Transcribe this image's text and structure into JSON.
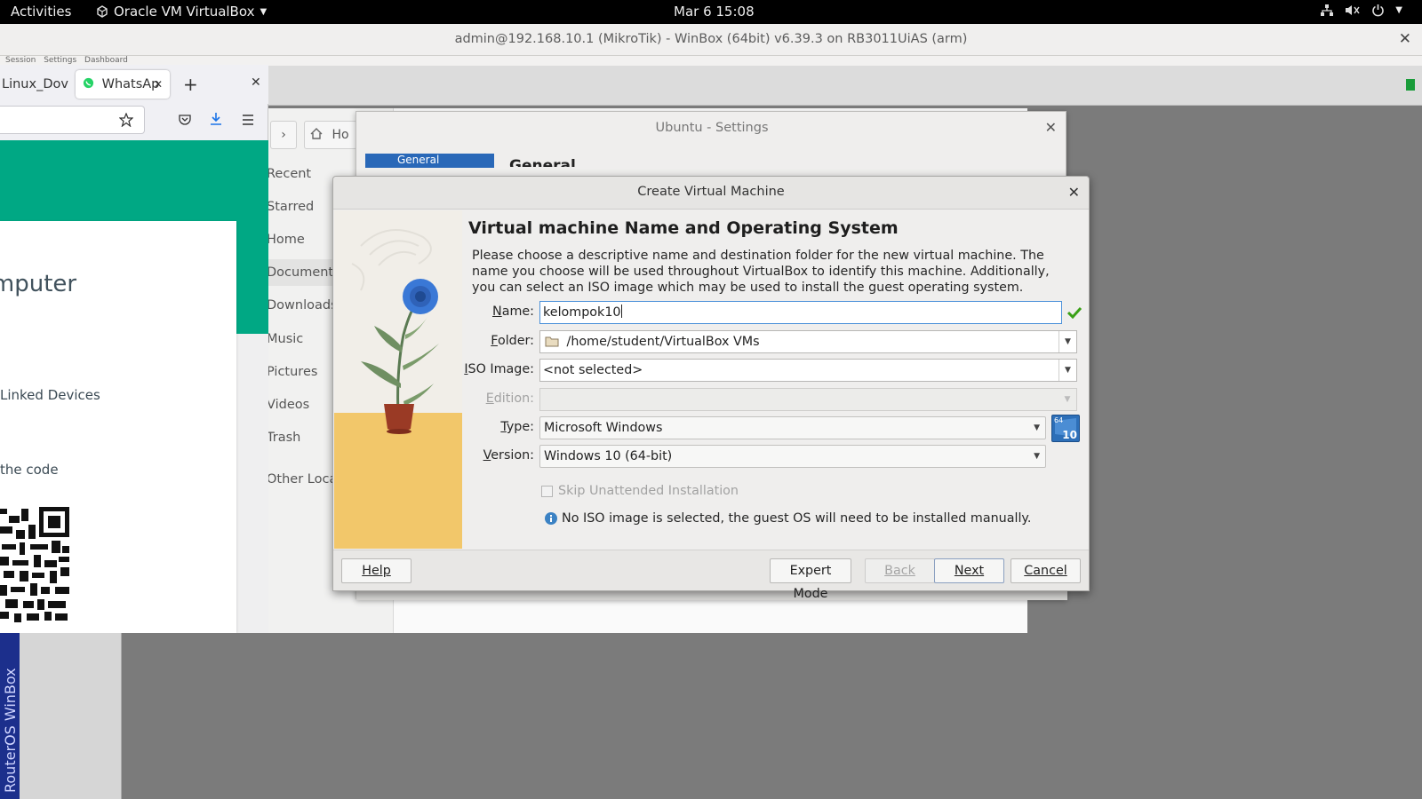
{
  "topbar": {
    "activities": "Activities",
    "app_name": "Oracle VM VirtualBox",
    "clock": "Mar 6  15:08"
  },
  "winbox": {
    "title": "admin@192.168.10.1 (MikroTik) - WinBox (64bit) v6.39.3 on RB3011UiAS (arm)",
    "menu": [
      "Session",
      "Settings",
      "Dashboard"
    ],
    "vertical_label": "RouterOS WinBox",
    "status_color": "#1a9c3a"
  },
  "files": {
    "home_crumb": "Ho",
    "sidebar": [
      "Recent",
      "Starred",
      "Home",
      "Documents",
      "Downloads",
      "Music",
      "Pictures",
      "Videos",
      "Trash",
      "Other Loca"
    ]
  },
  "firefox": {
    "tab1": "Linux_Dov",
    "tab2": "WhatsAp",
    "wa_title": "omputer",
    "wa_line1": "Linked Devices",
    "wa_line2": "the code",
    "wa_color": "#00a884"
  },
  "settings": {
    "title": "Ubuntu - Settings",
    "tab": "General",
    "heading_partial": "General"
  },
  "dialog": {
    "title": "Create Virtual Machine",
    "heading": "Virtual machine Name and Operating System",
    "description": "Please choose a descriptive name and destination folder for the new virtual machine. The name you choose will be used throughout VirtualBox to identify this machine. Additionally, you can select an ISO image which may be used to install the guest operating system.",
    "labels": {
      "name_key": "N",
      "name_rest": "ame:",
      "folder_key": "F",
      "folder_rest": "older:",
      "iso_key": "I",
      "iso_rest": "SO Image:",
      "edition_key": "E",
      "edition_rest": "dition:",
      "type_key": "T",
      "type_rest": "ype:",
      "version_key": "V",
      "version_rest": "ersion:"
    },
    "fields": {
      "name": "kelompok10",
      "folder": "/home/student/VirtualBox VMs",
      "iso": "<not selected>",
      "edition": "",
      "type": "Microsoft Windows",
      "version": "Windows 10 (64-bit)"
    },
    "os_badge": {
      "top": "64",
      "bottom": "10"
    },
    "skip_unattended": "Skip Unattended Installation",
    "info": "No ISO image is selected, the guest OS will need to be installed manually.",
    "buttons": {
      "help": "Help",
      "expert": "Expert Mode",
      "back": "Back",
      "next": "Next",
      "cancel": "Cancel"
    },
    "valid_color": "#3aa017"
  }
}
